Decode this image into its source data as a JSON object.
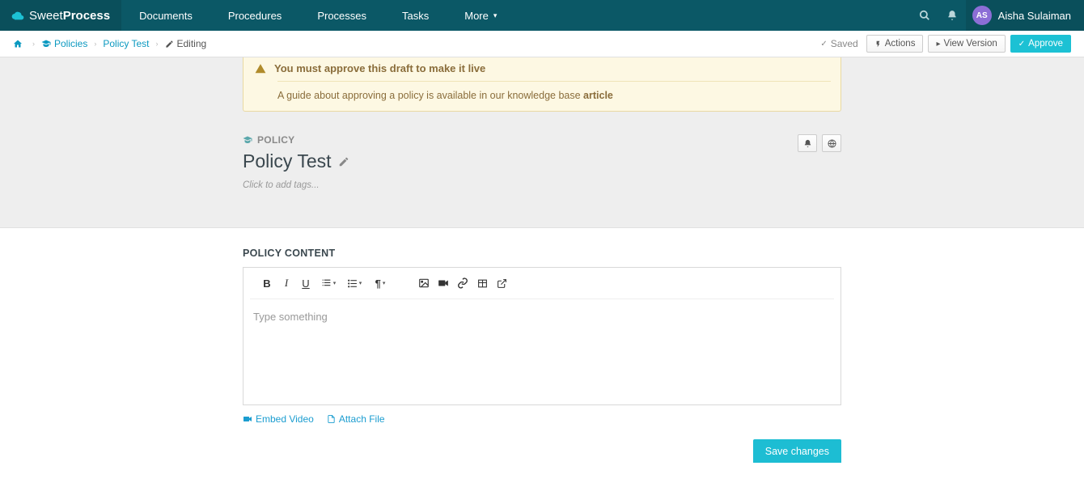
{
  "brand": {
    "part1": "Sweet",
    "part2": "Process"
  },
  "nav": {
    "items": [
      "Documents",
      "Procedures",
      "Processes",
      "Tasks",
      "More"
    ],
    "user": {
      "initials": "AS",
      "name": "Aisha Sulaiman"
    }
  },
  "breadcrumbs": {
    "policies": "Policies",
    "doc": "Policy Test",
    "state": "Editing"
  },
  "subbar": {
    "saved": "Saved",
    "actions": "Actions",
    "view_version": "View Version",
    "approve": "Approve"
  },
  "alert": {
    "line1": "You must approve this draft to make it live",
    "line2_pre": "A guide about approving a policy is available in our knowledge base ",
    "line2_link": "article"
  },
  "doc": {
    "type": "POLICY",
    "title": "Policy Test",
    "tags_prompt": "Click to add tags..."
  },
  "content": {
    "section_label": "POLICY CONTENT",
    "placeholder": "Type something"
  },
  "links": {
    "embed_video": "Embed Video",
    "attach_file": "Attach File"
  },
  "buttons": {
    "save_changes": "Save changes"
  }
}
